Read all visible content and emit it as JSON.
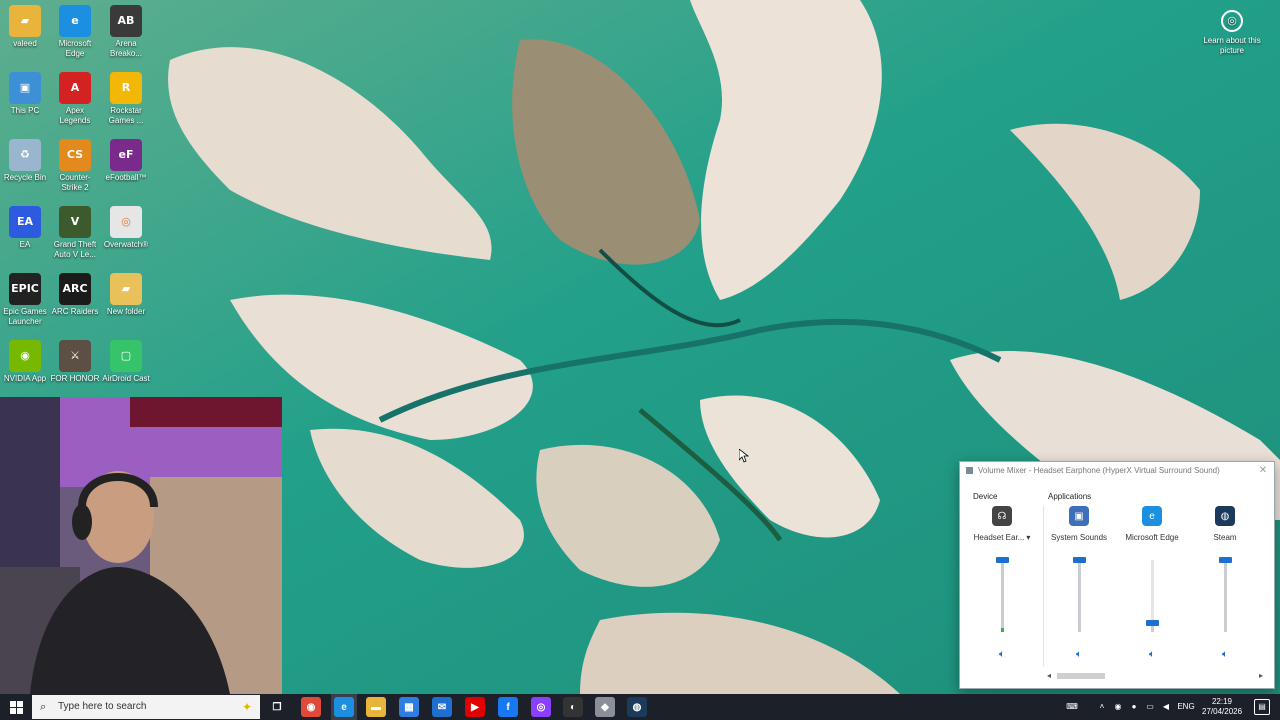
{
  "desktop": {
    "icons": [
      {
        "label": "valeed",
        "icon": "folder-icon",
        "color": "#e8b43c"
      },
      {
        "label": "Microsoft Edge",
        "icon": "edge-icon",
        "color": "#1d8fe0"
      },
      {
        "label": "Arena Breako...",
        "icon": "arena-breakout-icon",
        "color": "#3a3a3a"
      },
      {
        "label": "This PC",
        "icon": "computer-icon",
        "color": "#3d8fd6"
      },
      {
        "label": "Apex Legends",
        "icon": "apex-icon",
        "color": "#d42222"
      },
      {
        "label": "Rockstar Games ...",
        "icon": "rockstar-icon",
        "color": "#f2b707"
      },
      {
        "label": "Recycle Bin",
        "icon": "recycle-bin-icon",
        "color": "#9ab6cf"
      },
      {
        "label": "Counter-Strike 2",
        "icon": "counter-strike-icon",
        "color": "#e38a1e"
      },
      {
        "label": "eFootball™",
        "icon": "efootball-icon",
        "color": "#7a2a8a"
      },
      {
        "label": "EA",
        "icon": "ea-icon",
        "color": "#2d5be0"
      },
      {
        "label": "Grand Theft Auto V Le...",
        "icon": "gta-icon",
        "color": "#3c5a2c"
      },
      {
        "label": "Overwatch®",
        "icon": "overwatch-icon",
        "color": "#e6e6e6"
      },
      {
        "label": "Epic Games Launcher",
        "icon": "epic-games-icon",
        "color": "#222222"
      },
      {
        "label": "ARC Raiders",
        "icon": "arc-raiders-icon",
        "color": "#1b1b1b"
      },
      {
        "label": "New folder",
        "icon": "folder-icon",
        "color": "#e8c15a"
      },
      {
        "label": "NVIDIA App",
        "icon": "nvidia-icon",
        "color": "#76b900"
      },
      {
        "label": "FOR HONOR",
        "icon": "for-honor-icon",
        "color": "#5b5043"
      },
      {
        "label": "AirDroid Cast",
        "icon": "airdroid-icon",
        "color": "#35c46a"
      }
    ],
    "learn_about": "Learn about this picture"
  },
  "mixer": {
    "title": "Volume Mixer - Headset Earphone (HyperX Virtual Surround Sound)",
    "device_heading": "Device",
    "applications_heading": "Applications",
    "columns": [
      {
        "label": "Headset Ear...",
        "icon": "headset-icon",
        "icon_color": "#444444",
        "level": 1.0,
        "dropdown": "▾"
      },
      {
        "label": "System Sounds",
        "icon": "system-sounds-icon",
        "icon_color": "#3f6fb8",
        "level": 1.0
      },
      {
        "label": "Microsoft Edge",
        "icon": "edge-icon",
        "icon_color": "#1d8fe0",
        "level": 0.12
      },
      {
        "label": "Steam",
        "icon": "steam-icon",
        "icon_color": "#1b3a5c",
        "level": 1.0
      }
    ]
  },
  "taskbar": {
    "search_placeholder": "Type here to search",
    "apps": [
      {
        "icon": "task-view-icon",
        "color": "#1c2029"
      },
      {
        "icon": "chrome-icon",
        "color": "#e04a3a"
      },
      {
        "icon": "edge-icon",
        "color": "#1d8fe0"
      },
      {
        "icon": "file-explorer-icon",
        "color": "#e8b43c"
      },
      {
        "icon": "microsoft-store-icon",
        "color": "#2f7de0"
      },
      {
        "icon": "mail-icon",
        "color": "#1e6fd0"
      },
      {
        "icon": "youtube-icon",
        "color": "#e00000"
      },
      {
        "icon": "facebook-icon",
        "color": "#1877f2"
      },
      {
        "icon": "messenger-icon",
        "color": "#8a3ffc"
      },
      {
        "icon": "obs-icon",
        "color": "#333333"
      },
      {
        "icon": "shield-icon",
        "color": "#8a8f99"
      },
      {
        "icon": "steam-icon",
        "color": "#1b3a5c"
      }
    ],
    "language": "ENG",
    "time": "22:19",
    "date": "27/04/2026"
  }
}
